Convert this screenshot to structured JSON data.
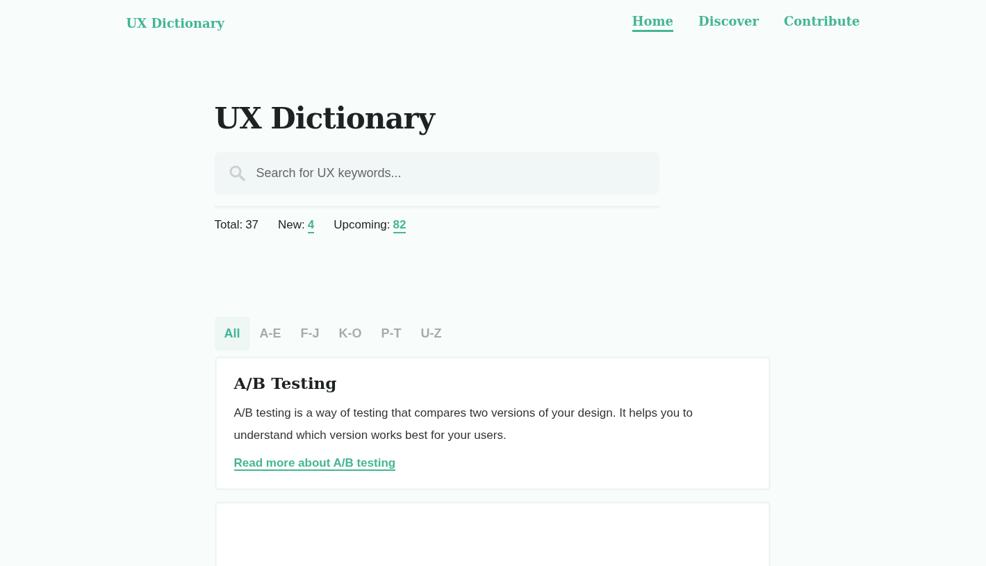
{
  "header": {
    "logo": "UX Dictionary",
    "nav": [
      {
        "label": "Home",
        "selected": true
      },
      {
        "label": "Discover",
        "selected": false
      },
      {
        "label": "Contribute",
        "selected": false
      }
    ]
  },
  "title": "UX Dictionary",
  "search": {
    "placeholder": "Search for UX keywords..."
  },
  "stats": [
    {
      "label": "Total:",
      "value": "37",
      "link": false
    },
    {
      "label": "New:",
      "value": "4",
      "link": true
    },
    {
      "label": "Upcoming:",
      "value": "82",
      "link": true
    }
  ],
  "filters": [
    {
      "label": "All",
      "selected": true
    },
    {
      "label": "A-E",
      "selected": false
    },
    {
      "label": "F-J",
      "selected": false
    },
    {
      "label": "K-O",
      "selected": false
    },
    {
      "label": "P-T",
      "selected": false
    },
    {
      "label": "U-Z",
      "selected": false
    }
  ],
  "entries": [
    {
      "title": "A/B Testing",
      "text": "A/B testing is a way of testing that compares two versions of your design. It helps you to understand which version works best for your users.",
      "link": "Read more about A/B testing"
    }
  ]
}
